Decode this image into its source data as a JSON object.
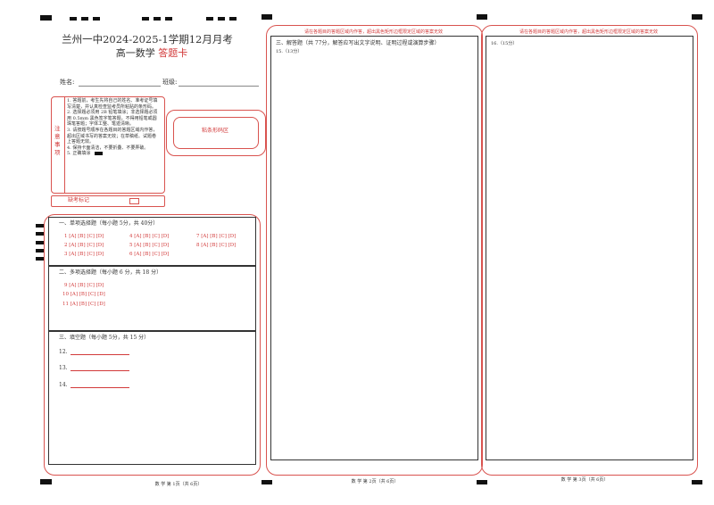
{
  "header": {
    "title": "兰州一中2024-2025-1学期12月月考",
    "subject": "高一数学",
    "card_label": "答题卡"
  },
  "student": {
    "name_label": "姓名:",
    "class_label": "班级:"
  },
  "notes": {
    "side_label": "注意事项",
    "items": [
      "1. 答题前，考生先将自己的姓名、准考证号填写清楚，并认真检查监考员所粘贴的条形码。",
      "2. 选择题必须用 2B 铅笔填涂；非选择题必须用 0.5mm 黑色签字笔答题，不得用铅笔或圆珠笔答题；字体工整、笔迹清晰。",
      "3. 请按题号顺序在各题目的答题区域内作答，超出区域书写的答案无效；在草稿纸、试题卷上答题无效。",
      "4. 保持卡面清洁，不要折叠、不要弄破。",
      "5. 正确填涂"
    ]
  },
  "barcode_label": "粘条形码区",
  "absent_label": "缺考标记",
  "section1": {
    "title": "一、单项选择题（每小题 5分，共 40分）",
    "rows": [
      "1 [A] [B] [C] [D]",
      "4 [A] [B] [C] [D]",
      "7 [A] [B] [C] [D]",
      "2 [A] [B] [C] [D]",
      "5 [A] [B] [C] [D]",
      "8 [A] [B] [C] [D]",
      "3 [A] [B] [C] [D]",
      "6 [A] [B] [C] [D]"
    ]
  },
  "section2": {
    "title": "二、多项选择题（每小题 6 分，共 18 分）",
    "rows": [
      "9 [A] [B] [C] [D]",
      "10 [A] [B] [C] [D]",
      "11 [A] [B] [C] [D]"
    ]
  },
  "section3": {
    "title": "三、填空题（每小题 5分，共 15 分）",
    "items": [
      "12.",
      "13.",
      "14."
    ]
  },
  "page2": {
    "warning": "请在各题目的答题区域内作答，超出黑色矩形边框限定区域的答案无效",
    "section_title": "三、解答题（共 77分，解答应写出文字说明、证明过程或演算步骤）",
    "q15": "15.（13分）"
  },
  "page3": {
    "warning": "请在各题目的答题区域内作答，超出黑色矩形边框限定区域的答案无效",
    "q16": "16.（15分）"
  },
  "footers": [
    "数 学 第 1页（共 6页）",
    "数 学 第 2页（共 6页）",
    "数 学 第 3页（共 6页）"
  ]
}
